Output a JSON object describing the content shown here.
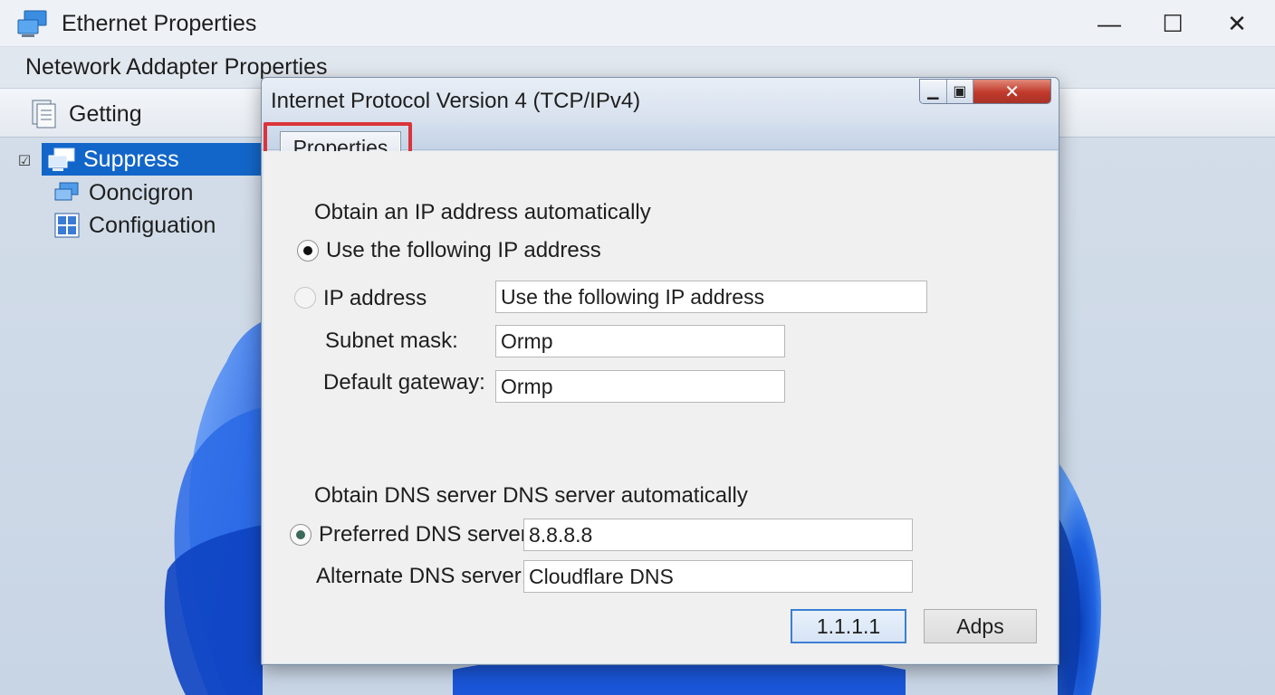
{
  "window": {
    "title": "Ethernet Properties",
    "subheader": "Netework Addapter Properties",
    "controls": {
      "minimize": "—",
      "maximize": "☐",
      "close": "✕"
    }
  },
  "toolbar": {
    "getting_label": "Getting"
  },
  "tree": {
    "items": [
      {
        "label": "Suppress",
        "selected": true
      },
      {
        "label": "Ooncigron",
        "selected": false
      },
      {
        "label": "Configuation",
        "selected": false
      }
    ]
  },
  "dialog": {
    "title": "Internet Protocol Version 4 (TCP/IPv4)",
    "controls": {
      "minimize": "▁",
      "maximize": "▣",
      "close": "✕"
    },
    "tab_label": "Properties",
    "ip": {
      "obtain_auto_label": "Obtain an IP address automatically",
      "use_following_label": "Use the following IP address",
      "ip_address_label": "IP address",
      "ip_address_value": "Use the following IP address",
      "subnet_label": "Subnet mask:",
      "subnet_value": "Ormp",
      "gateway_label": "Default gateway:",
      "gateway_value": "Ormp"
    },
    "dns": {
      "obtain_auto_label": "Obtain DNS server DNS server automatically",
      "preferred_label": "Preferred DNS server:",
      "preferred_value": "8.8.8.8",
      "alternate_label": "Alternate DNS server:",
      "alternate_value": "Cloudflare DNS"
    },
    "buttons": {
      "ok_label": "1.1.1.1",
      "apply_label": "Adps"
    }
  },
  "colors": {
    "selection": "#1366c9",
    "highlight_border": "#d9353a",
    "wallpaper_accent": "#1f62e0"
  }
}
